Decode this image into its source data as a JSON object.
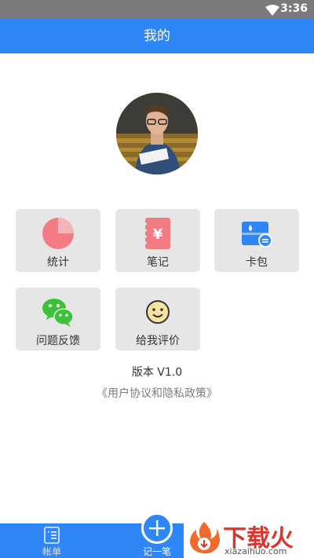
{
  "status_bar": {
    "time": "3:36"
  },
  "header": {
    "title": "我的"
  },
  "menu": {
    "statistics": "统计",
    "notes": "笔记",
    "wallet": "卡包",
    "feedback": "问题反馈",
    "rate": "给我评价"
  },
  "footer": {
    "version": "版本 V1.0",
    "agreement": "《用户协议和隐私政策》"
  },
  "tab_bar": {
    "bills": "帐单",
    "record": "记一笔"
  },
  "watermark": {
    "text": "下载火",
    "domain": "xiazaihuo.com"
  },
  "colors": {
    "primary": "#2f86f6",
    "tile": "#e6e6e6",
    "status_bar": "#7a7a7a"
  }
}
